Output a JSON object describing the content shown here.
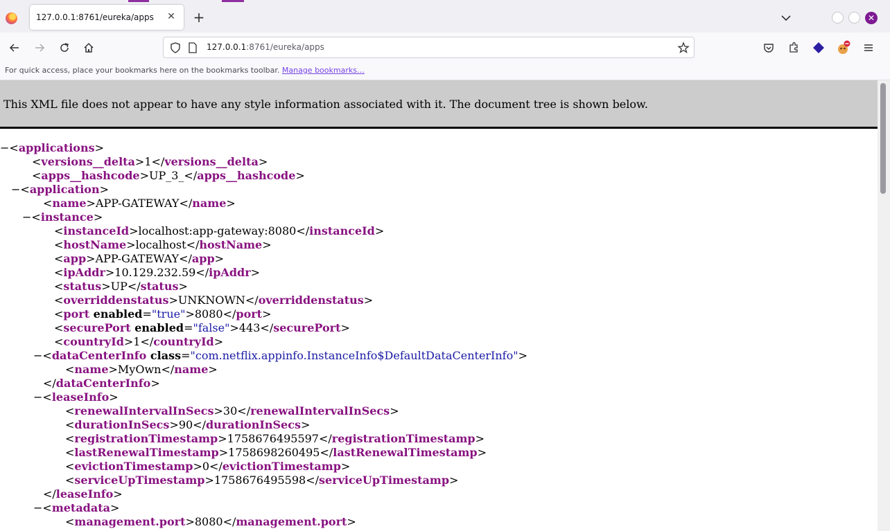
{
  "browser": {
    "tab_title": "127.0.0.1:8761/eureka/apps",
    "tab_close": "✕",
    "new_tab": "+",
    "url_host": "127.0.0.1",
    "url_path": ":8761/eureka/apps",
    "bookmarks_hint": "For quick access, place your bookmarks here on the bookmarks toolbar.",
    "manage_bookmarks": "Manage bookmarks…",
    "window_close": "✕",
    "accent_color": "#8f2fa0"
  },
  "page": {
    "xml_notice": "This XML file does not appear to have any style information associated with it. The document tree is shown below."
  },
  "xml_lines": [
    {
      "indent": 0,
      "fold": true,
      "open": "applications"
    },
    {
      "indent": 2,
      "open": "versions__delta",
      "text": "1",
      "close": "versions__delta"
    },
    {
      "indent": 2,
      "open": "apps__hashcode",
      "text": "UP_3_",
      "close": "apps__hashcode"
    },
    {
      "indent": 1,
      "fold": true,
      "open": "application"
    },
    {
      "indent": 3,
      "open": "name",
      "text": "APP-GATEWAY",
      "close": "name"
    },
    {
      "indent": 2,
      "fold": true,
      "open": "instance"
    },
    {
      "indent": 4,
      "open": "instanceId",
      "text": "localhost:app-gateway:8080",
      "close": "instanceId"
    },
    {
      "indent": 4,
      "open": "hostName",
      "text": "localhost",
      "close": "hostName"
    },
    {
      "indent": 4,
      "open": "app",
      "text": "APP-GATEWAY",
      "close": "app"
    },
    {
      "indent": 4,
      "open": "ipAddr",
      "text": "10.129.232.59",
      "close": "ipAddr"
    },
    {
      "indent": 4,
      "open": "status",
      "text": "UP",
      "close": "status"
    },
    {
      "indent": 4,
      "open": "overriddenstatus",
      "text": "UNKNOWN",
      "close": "overriddenstatus"
    },
    {
      "indent": 4,
      "open": "port",
      "attr": "enabled",
      "aval": "true",
      "text": "8080",
      "close": "port"
    },
    {
      "indent": 4,
      "open": "securePort",
      "attr": "enabled",
      "aval": "false",
      "text": "443",
      "close": "securePort"
    },
    {
      "indent": 4,
      "open": "countryId",
      "text": "1",
      "close": "countryId"
    },
    {
      "indent": 3,
      "fold": true,
      "open": "dataCenterInfo",
      "attr": "class",
      "aval": "com.netflix.appinfo.InstanceInfo$DefaultDataCenterInfo"
    },
    {
      "indent": 5,
      "open": "name",
      "text": "MyOwn",
      "close": "name"
    },
    {
      "indent": 4,
      "closeonly": "dataCenterInfo"
    },
    {
      "indent": 3,
      "fold": true,
      "open": "leaseInfo"
    },
    {
      "indent": 5,
      "open": "renewalIntervalInSecs",
      "text": "30",
      "close": "renewalIntervalInSecs"
    },
    {
      "indent": 5,
      "open": "durationInSecs",
      "text": "90",
      "close": "durationInSecs"
    },
    {
      "indent": 5,
      "open": "registrationTimestamp",
      "text": "1758676495597",
      "close": "registrationTimestamp"
    },
    {
      "indent": 5,
      "open": "lastRenewalTimestamp",
      "text": "1758698260495",
      "close": "lastRenewalTimestamp"
    },
    {
      "indent": 5,
      "open": "evictionTimestamp",
      "text": "0",
      "close": "evictionTimestamp"
    },
    {
      "indent": 5,
      "open": "serviceUpTimestamp",
      "text": "1758676495598",
      "close": "serviceUpTimestamp"
    },
    {
      "indent": 4,
      "closeonly": "leaseInfo"
    },
    {
      "indent": 3,
      "fold": true,
      "open": "metadata"
    },
    {
      "indent": 5,
      "open": "management.port",
      "text": "8080",
      "close": "management.port"
    }
  ]
}
